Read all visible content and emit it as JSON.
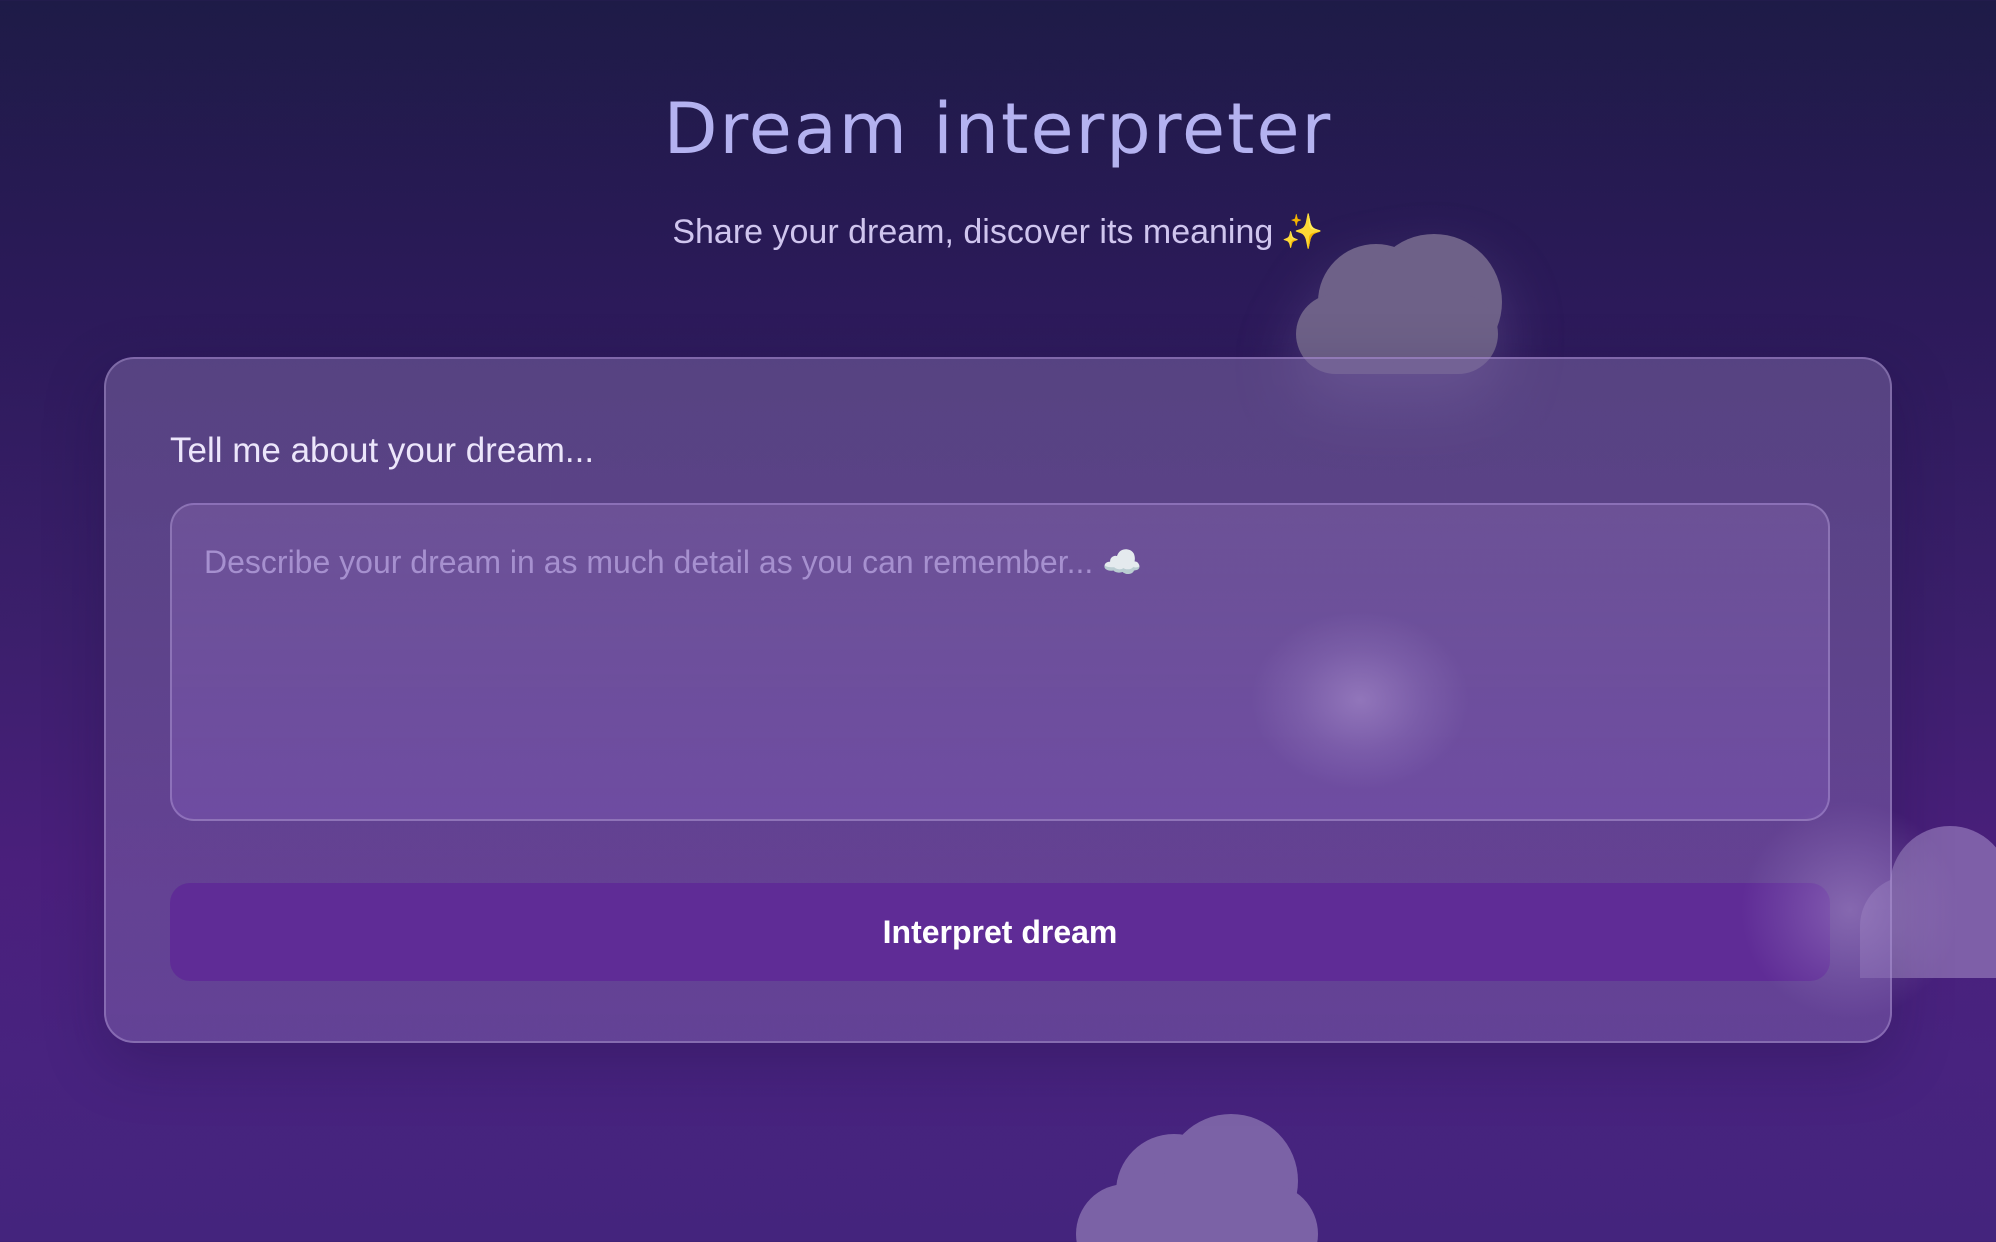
{
  "header": {
    "title": "Dream interpreter",
    "subtitle": "Share your dream, discover its meaning",
    "subtitle_icon": "sparkles-icon",
    "subtitle_icon_glyph": "✨"
  },
  "form": {
    "label": "Tell me about your dream...",
    "input_value": "",
    "input_placeholder": "Describe your dream in as much detail as you can remember... ☁️",
    "submit_label": "Interpret dream"
  },
  "colors": {
    "title": "#b4b2f0",
    "button": "#5f2c96",
    "background_top": "#1e1b47",
    "background_bottom": "#4a1f7c"
  }
}
